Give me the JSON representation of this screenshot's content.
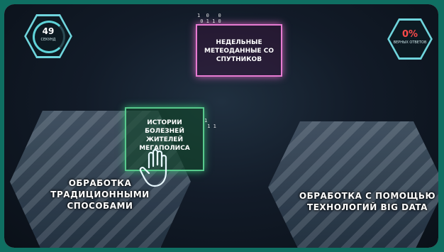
{
  "hud": {
    "timer_value": "49",
    "timer_label": "секунд",
    "score_value": "0%",
    "score_label": "верных ответов"
  },
  "cards": {
    "satellite": "Недельные метеоданные со спутников",
    "medical": "Истории болезней жителей мегаполиса"
  },
  "zones": {
    "traditional": "Обработка традиционными способами",
    "big_data": "Обработка с помощью технологий Big Data"
  },
  "bits": {
    "top": "1  0   0\n 0 1 1 0",
    "mid": "1\n 1 1"
  },
  "colors": {
    "accent": "#6fd4dc",
    "pink": "#e77bd2",
    "green": "#58c98c",
    "score_red": "#ff4a4a",
    "frame_bg": "#0f6f62"
  }
}
